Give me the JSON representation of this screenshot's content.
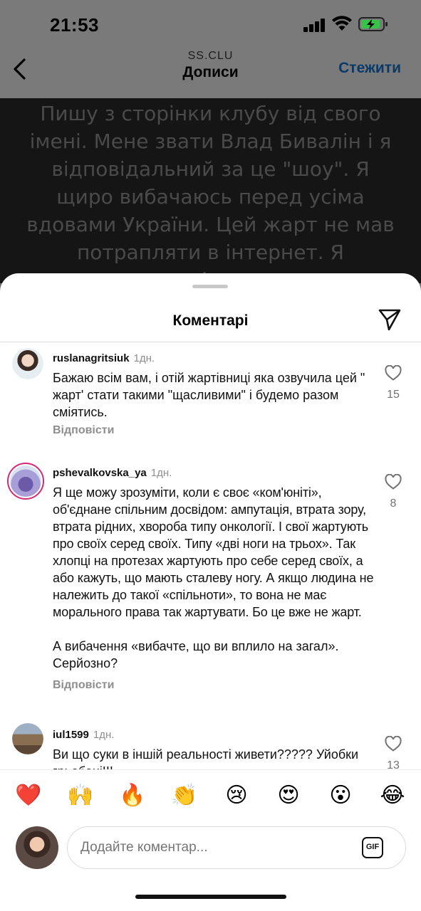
{
  "status_bar": {
    "time": "21:53"
  },
  "header": {
    "subtitle": "SS.CLU",
    "title": "Дописи",
    "follow_label": "Стежити"
  },
  "post": {
    "text": "Пишу з сторінки клубу від свого імені. Мене звати Влад Бивалін і я відповідальний за це \"шоу\". Я щиро вибачаюсь перед усіма вдовами України. Цей жарт не мав потрапляти в інтернет. Я недоглядів, тому що"
  },
  "comments_sheet": {
    "title": "Коментарі",
    "comments": [
      {
        "username": "ruslanagritsiuk",
        "time": "1дн.",
        "text": "Бажаю всім вам, і отій жартівниці яка озвучила цей \" жарт' стати такими \"щасливими\" і будемо разом сміятись.",
        "likes": "15",
        "reply_label": "Відповісти"
      },
      {
        "username": "pshevalkovska_ya",
        "time": "1дн.",
        "text": "Я ще можу зрозуміти, коли є своє «ком'юніті», об'єднане спільним досвідом: ампутація, втрата зору, втрата рідних, хвороба типу онкології. І свої жартують про своїх серед своїх. Типу «дві ноги на трьох». Так хлопці на протезах жартують про себе серед своїх, а або кажуть, що мають сталеву ногу. А якщо людина не належить до такої «спільноти», то вона не має морального права так жартувати. Бо це вже не жарт.",
        "text2": "А вибачення «вибачте, що ви вплило на загал». Серйозно?",
        "likes": "8",
        "reply_label": "Відповісти"
      },
      {
        "username": "iul1599",
        "time": "1дн.",
        "text": "Ви що суки в іншій реальності живети????? Уйобки грьобані!!!",
        "likes": "13"
      }
    ]
  },
  "emoji_bar": [
    "❤️",
    "🙌",
    "🔥",
    "👏",
    "😢",
    "😍",
    "😮",
    "😂"
  ],
  "composer": {
    "placeholder": "Додайте коментар...",
    "gif_label": "GIF"
  },
  "colors": {
    "follow": "#0b3a66",
    "like_gray": "#737373",
    "story_ring": "#d62976"
  }
}
